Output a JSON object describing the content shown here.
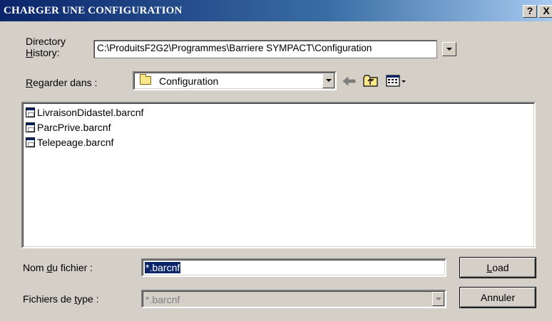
{
  "window": {
    "title": "CHARGER UNE CONFIGURATION",
    "help_label": "?",
    "close_label": "X"
  },
  "history": {
    "label_line1": "Directory",
    "label_line2_accel": "H",
    "label_line2_rest": "istory:",
    "value": "C:\\ProduitsF2G2\\Programmes\\Barriere SYMPACT\\Configuration"
  },
  "look_in": {
    "label_accel": "R",
    "label_rest": "egarder dans :",
    "value": "Configuration",
    "icons": [
      "back-arrow-icon",
      "up-folder-icon",
      "view-menu-icon"
    ]
  },
  "files": [
    {
      "name": "LivraisonDidastel.barcnf",
      "icon": "file-icon"
    },
    {
      "name": "ParcPrive.barcnf",
      "icon": "file-icon"
    },
    {
      "name": "Telepeage.barcnf",
      "icon": "file-icon"
    }
  ],
  "filename": {
    "label_pre": "Nom ",
    "label_accel": "d",
    "label_post": "u fichier :",
    "value": "*.barcnf"
  },
  "filetype": {
    "label_pre": "Fichiers de ",
    "label_accel": "t",
    "label_post": "ype :",
    "value": "*.barcnf"
  },
  "buttons": {
    "load_accel": "L",
    "load_rest": "oad",
    "cancel": "Annuler"
  },
  "colors": {
    "titlebar": "#0a246a",
    "face": "#d4d0c8",
    "selection": "#0a246a"
  }
}
